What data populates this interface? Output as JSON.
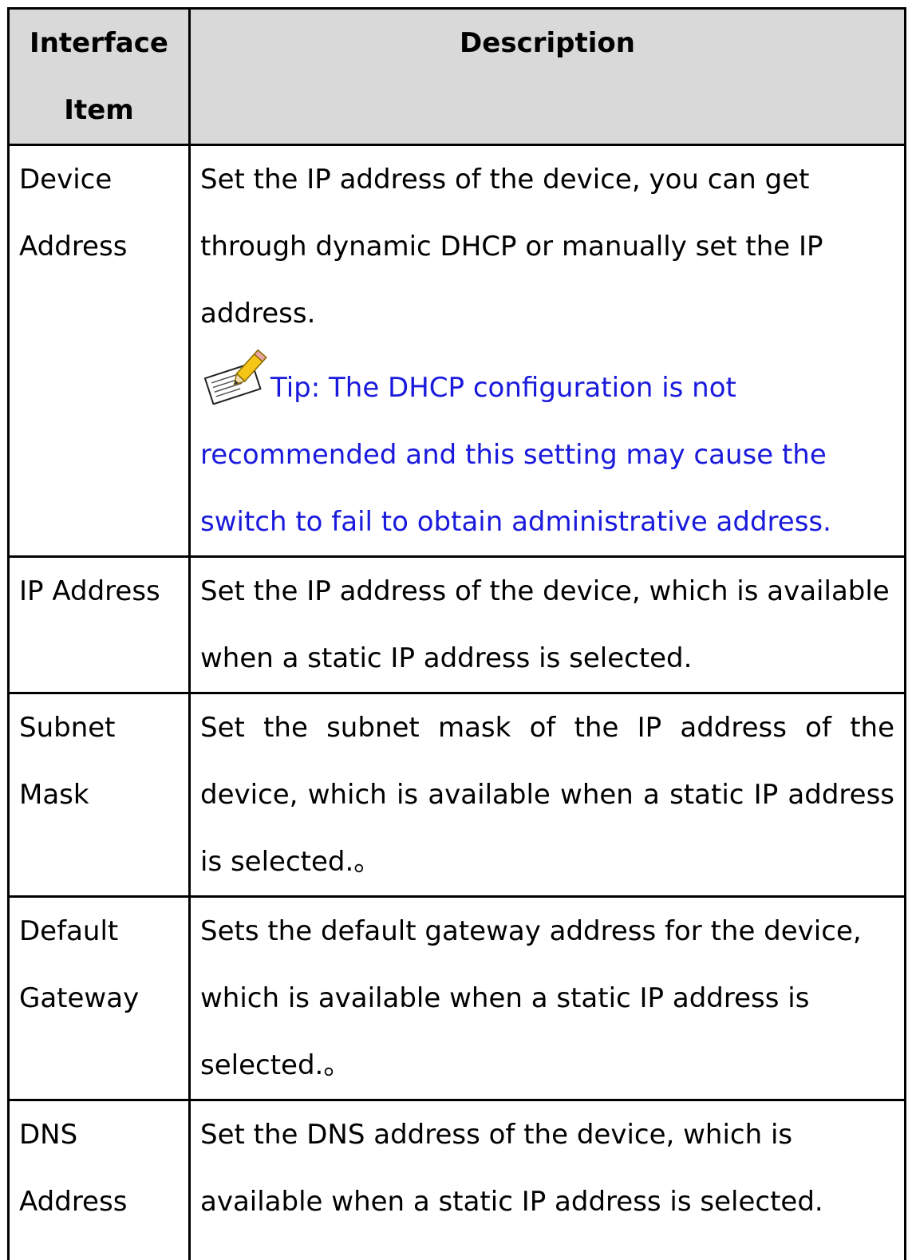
{
  "table": {
    "headers": [
      "Interface Item",
      "Description"
    ],
    "header_col1_line1": "Interface",
    "header_col1_line2": "Item",
    "header_col2": "Description",
    "rows": [
      {
        "item": "Device Address",
        "description": "Set the IP address of the device, you can get through dynamic DHCP or manually set the IP address.",
        "tip": "Tip: The DHCP configuration is not recommended and this setting may cause the switch to fail to obtain administrative address."
      },
      {
        "item": "IP Address",
        "description": "Set the IP address of the device, which is available when a static IP address is selected."
      },
      {
        "item": "Subnet Mask",
        "description": "Set the subnet mask of the IP address of the device, which is available when a static IP address is selected.。"
      },
      {
        "item": "Default Gateway",
        "description": "Sets the default gateway address for the device, which is available when a static IP address is selected.。"
      },
      {
        "item": "DNS Address",
        "description": "Set the DNS address of the device, which is available when a static IP address is selected."
      }
    ]
  },
  "icons": {
    "tip_icon": "note-pencil-icon"
  },
  "colors": {
    "header_background": "#d9d9d9",
    "tip_text": "#1a1adc",
    "border": "#000000"
  }
}
